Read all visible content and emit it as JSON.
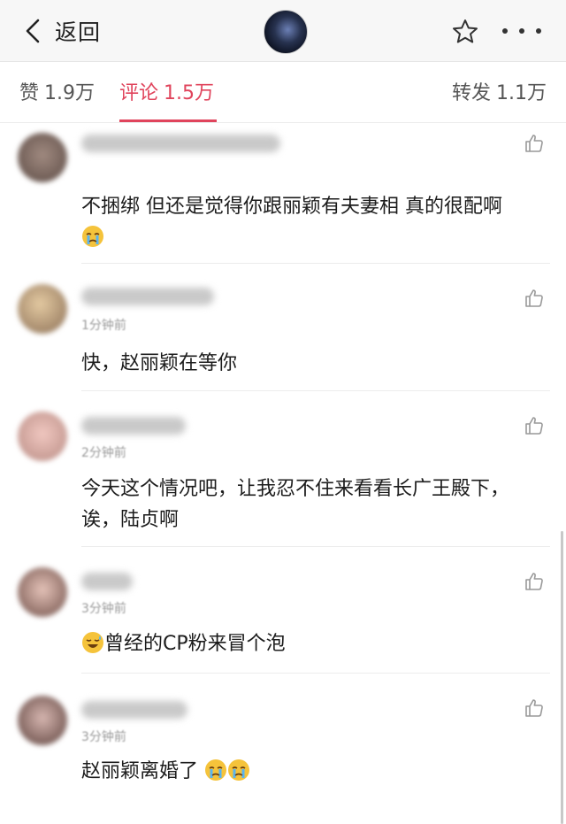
{
  "header": {
    "back_label": "返回",
    "icons": {
      "back": "chevron-left-icon",
      "star": "star-outline-icon",
      "more": "more-horizontal-icon"
    }
  },
  "tabs": {
    "like": {
      "label": "赞",
      "count": "1.9万"
    },
    "comment": {
      "label": "评论",
      "count": "1.5万"
    },
    "repost": {
      "label": "转发",
      "count": "1.1万"
    },
    "active_color": "#e0445c"
  },
  "comments": [
    {
      "time": "",
      "text": "不捆绑 但还是觉得你跟丽颖有夫妻相 真的很配啊",
      "emoji_after": "crying-emoji"
    },
    {
      "time": "1分钟前",
      "text": "快，赵丽颖在等你"
    },
    {
      "time": "2分钟前",
      "text": "今天这个情况吧，让我忍不住来看看长广王殿下，诶，陆贞啊"
    },
    {
      "time": "3分钟前",
      "text": "曾经的CP粉来冒个泡",
      "emoji_before": "sweat-smile-emoji"
    },
    {
      "time": "3分钟前",
      "text": "赵丽颖离婚了",
      "emoji_after": "crying-emoji x2"
    }
  ]
}
